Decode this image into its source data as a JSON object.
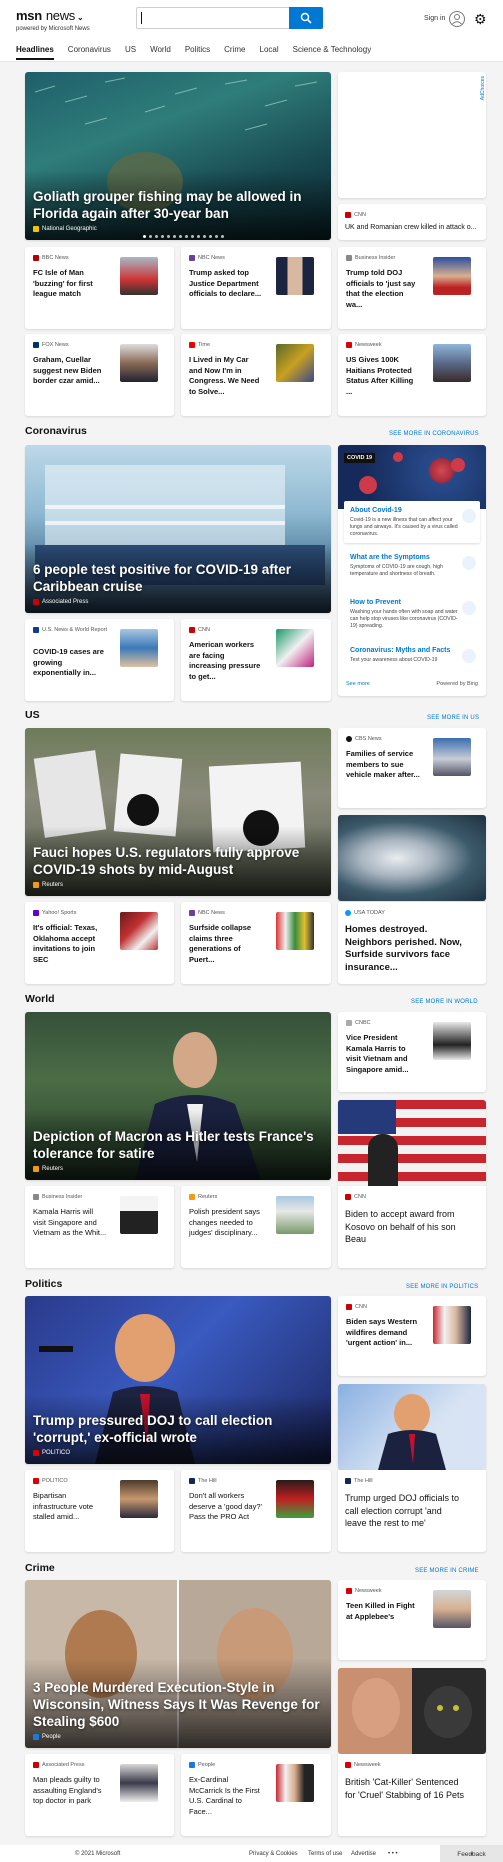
{
  "header": {
    "brand": "msn",
    "section_label": "news",
    "powered_by": "powered by Microsoft News",
    "search_value": "",
    "sign_in": "Sign in"
  },
  "nav": [
    "Headlines",
    "Coronavirus",
    "US",
    "World",
    "Politics",
    "Crime",
    "Local",
    "Science & Technology"
  ],
  "top": {
    "hero": {
      "title": "Goliath grouper fishing may be allowed in Florida again after 30-year ban",
      "source": "National Geographic"
    },
    "ad_label": "AdChoices",
    "side": {
      "source": "CNN",
      "title": "UK and Romanian crew killed in attack o..."
    },
    "row1": [
      {
        "source": "BBC News",
        "title": "FC Isle of Man 'buzzing' for first league match"
      },
      {
        "source": "NBC News",
        "title": "Trump asked top Justice Department officials to declare..."
      },
      {
        "source": "Business Insider",
        "title": "Trump told DOJ officials to 'just say that the election wa..."
      }
    ],
    "row2": [
      {
        "source": "FOX News",
        "title": "Graham, Cuellar suggest new Biden border czar amid..."
      },
      {
        "source": "Time",
        "title": "I Lived in My Car and Now I'm in Congress. We Need to Solve..."
      },
      {
        "source": "Newsweek",
        "title": "US Gives 100K Haitians Protected Status After Killing ..."
      }
    ]
  },
  "coronavirus": {
    "section": "Coronavirus",
    "see_more": "SEE MORE IN CORONAVIRUS",
    "hero": {
      "title": "6 people test positive for COVID-19 after Caribbean cruise",
      "source": "Associated Press"
    },
    "row": [
      {
        "source": "U.S. News & World Report",
        "title": "COVID-19 cases are growing exponentially in..."
      },
      {
        "source": "CNN",
        "title": "American workers are facing increasing pressure to get..."
      }
    ],
    "info": {
      "badge": "COVID 19",
      "items": [
        {
          "title": "About Covid-19",
          "desc": "Covid-19 is a new illness that can affect your lungs and airways. It's caused by a virus called coronavirus."
        },
        {
          "title": "What are the Symptoms",
          "desc": "Symptoms of COVID-19 are cough, high temperature and shortness of breath."
        },
        {
          "title": "How to Prevent",
          "desc": "Washing your hands often with soap and water can help stop viruses like coronavirus (COVID-19) spreading."
        },
        {
          "title": "Coronavirus: Myths and Facts",
          "desc": "Test your awareness about COVID-19"
        }
      ],
      "see_more": "See more",
      "powered": "Powered by Bing"
    }
  },
  "us": {
    "section": "US",
    "see_more": "SEE MORE IN US",
    "hero": {
      "title": "Fauci hopes U.S. regulators fully approve COVID-19 shots by mid-August",
      "source": "Reuters"
    },
    "side": {
      "source": "CBS News",
      "title": "Families of service members to sue vehicle maker after..."
    },
    "side2": {
      "source": "USA TODAY",
      "title": "Homes destroyed. Neighbors perished. Now, Surfside survivors face insurance..."
    },
    "row": [
      {
        "source": "Yahoo! Sports",
        "title": "It's official: Texas, Oklahoma accept invitations to join SEC"
      },
      {
        "source": "NBC News",
        "title": "Surfside collapse claims three generations of Puert..."
      }
    ]
  },
  "world": {
    "section": "World",
    "see_more": "SEE MORE IN WORLD",
    "hero": {
      "title": "Depiction of Macron as Hitler tests France's tolerance for satire",
      "source": "Reuters"
    },
    "side": {
      "source": "CNBC",
      "title": "Vice President Kamala Harris to visit Vietnam and Singapore amid..."
    },
    "side2": {
      "source": "CNN",
      "title": "Biden to accept award from Kosovo on behalf of his son Beau"
    },
    "row": [
      {
        "source": "Business Insider",
        "title": "Kamala Harris will visit Singapore and Vietnam as the Whit..."
      },
      {
        "source": "Reuters",
        "title": "Polish president says changes needed to judges' disciplinary..."
      }
    ]
  },
  "politics": {
    "section": "Politics",
    "see_more": "SEE MORE IN POLITICS",
    "hero": {
      "title": "Trump pressured DOJ to call election 'corrupt,' ex-official wrote",
      "source": "POLITICO"
    },
    "side": {
      "source": "CNN",
      "title": "Biden says Western wildfires demand 'urgent action' in..."
    },
    "side2": {
      "source": "The Hill",
      "title": "Trump urged DOJ officials to call election corrupt 'and leave the rest to me'"
    },
    "row": [
      {
        "source": "POLITICO",
        "title": "Bipartisan infrastructure vote stalled amid..."
      },
      {
        "source": "The Hill",
        "title": "Don't all workers deserve a 'good day?' Pass the PRO Act"
      }
    ]
  },
  "crime": {
    "section": "Crime",
    "see_more": "SEE MORE IN CRIME",
    "hero": {
      "title": "3 People Murdered Execution-Style in Wisconsin, Witness Says It Was Revenge for Stealing $600",
      "source": "People"
    },
    "side": {
      "source": "Newsweek",
      "title": "Teen Killed in Fight at Applebee's"
    },
    "side2": {
      "source": "Newsweek",
      "title": "British 'Cat-Killer' Sentenced for 'Cruel' Stabbing of 16 Pets"
    },
    "row": [
      {
        "source": "Associated Press",
        "title": "Man pleads guilty to assaulting England's top doctor in park"
      },
      {
        "source": "People",
        "title": "Ex-Cardinal McCarrick Is the First U.S. Cardinal to Face..."
      }
    ]
  },
  "footer": {
    "copyright": "© 2021 Microsoft",
    "privacy": "Privacy & Cookies",
    "terms": "Terms of use",
    "advertise": "Advertise",
    "more": "• • •",
    "feedback": "Feedback"
  }
}
